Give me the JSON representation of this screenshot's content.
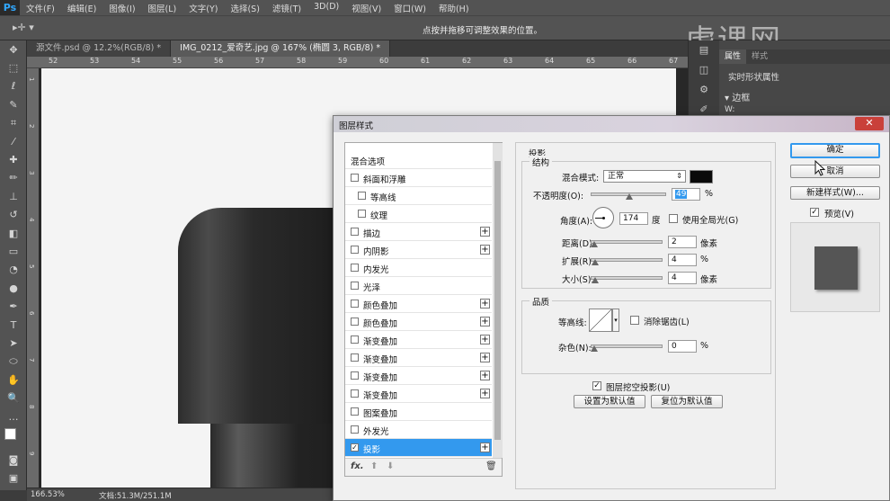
{
  "app": {
    "logo": "Ps",
    "menu": [
      "文件(F)",
      "编辑(E)",
      "图像(I)",
      "图层(L)",
      "文字(Y)",
      "选择(S)",
      "滤镜(T)",
      "3D(D)",
      "视图(V)",
      "窗口(W)",
      "帮助(H)"
    ],
    "options_hint": "点按并拖移可调整效果的位置。",
    "watermark": "虎课网"
  },
  "tabs": [
    {
      "label": "源文件.psd @ 12.2%(RGB/8) *",
      "active": false
    },
    {
      "label": "IMG_0212_爱奇艺.jpg @ 167% (椭圆 3, RGB/8) *",
      "active": true
    }
  ],
  "ruler": {
    "top": [
      "52",
      "53",
      "54",
      "55",
      "56",
      "57",
      "58",
      "59",
      "60",
      "61",
      "62",
      "63",
      "64",
      "65",
      "66",
      "67"
    ],
    "left": [
      "1",
      "2",
      "3",
      "4",
      "5",
      "6",
      "7",
      "8",
      "9"
    ]
  },
  "status": {
    "zoom": "166.53%",
    "doc": "文档:51.3M/251.1M"
  },
  "props": {
    "tabs": [
      "属性",
      "样式"
    ],
    "title": "实时形状属性",
    "section": "边框",
    "w_label": "W:"
  },
  "dialog": {
    "title": "图层样式",
    "close": "✕",
    "styles": [
      {
        "label": "混合选项",
        "checkbox": false,
        "indent": false,
        "plus": false,
        "checked": false,
        "selected": false
      },
      {
        "label": "斜面和浮雕",
        "checkbox": true,
        "indent": false,
        "plus": false,
        "checked": false,
        "selected": false
      },
      {
        "label": "等高线",
        "checkbox": true,
        "indent": true,
        "plus": false,
        "checked": false,
        "selected": false
      },
      {
        "label": "纹理",
        "checkbox": true,
        "indent": true,
        "plus": false,
        "checked": false,
        "selected": false
      },
      {
        "label": "描边",
        "checkbox": true,
        "indent": false,
        "plus": true,
        "checked": false,
        "selected": false
      },
      {
        "label": "内阴影",
        "checkbox": true,
        "indent": false,
        "plus": true,
        "checked": false,
        "selected": false
      },
      {
        "label": "内发光",
        "checkbox": true,
        "indent": false,
        "plus": false,
        "checked": false,
        "selected": false
      },
      {
        "label": "光泽",
        "checkbox": true,
        "indent": false,
        "plus": false,
        "checked": false,
        "selected": false
      },
      {
        "label": "颜色叠加",
        "checkbox": true,
        "indent": false,
        "plus": true,
        "checked": false,
        "selected": false
      },
      {
        "label": "颜色叠加",
        "checkbox": true,
        "indent": false,
        "plus": true,
        "checked": false,
        "selected": false
      },
      {
        "label": "渐变叠加",
        "checkbox": true,
        "indent": false,
        "plus": true,
        "checked": false,
        "selected": false
      },
      {
        "label": "渐变叠加",
        "checkbox": true,
        "indent": false,
        "plus": true,
        "checked": false,
        "selected": false
      },
      {
        "label": "渐变叠加",
        "checkbox": true,
        "indent": false,
        "plus": true,
        "checked": false,
        "selected": false
      },
      {
        "label": "渐变叠加",
        "checkbox": true,
        "indent": false,
        "plus": true,
        "checked": false,
        "selected": false
      },
      {
        "label": "图案叠加",
        "checkbox": true,
        "indent": false,
        "plus": false,
        "checked": false,
        "selected": false
      },
      {
        "label": "外发光",
        "checkbox": true,
        "indent": false,
        "plus": false,
        "checked": false,
        "selected": false
      },
      {
        "label": "投影",
        "checkbox": true,
        "indent": false,
        "plus": true,
        "checked": true,
        "selected": true
      }
    ],
    "footer": {
      "fx": "fx.",
      "up": "⬆",
      "down": "⬇",
      "trash": "🗑"
    },
    "drop_shadow": {
      "heading": "投影",
      "structure": "结构",
      "blend_label": "混合模式:",
      "blend_value": "正常",
      "shadow_color": "#0a0a0a",
      "opacity_label": "不透明度(O):",
      "opacity_value": "49",
      "opacity_unit": "%",
      "angle_label": "角度(A):",
      "angle_value": "174",
      "angle_unit": "度",
      "global_light": "使用全局光(G)",
      "distance_label": "距离(D):",
      "distance_value": "2",
      "distance_unit": "像素",
      "spread_label": "扩展(R):",
      "spread_value": "4",
      "spread_unit": "%",
      "size_label": "大小(S):",
      "size_value": "4",
      "size_unit": "像素",
      "quality": "品质",
      "contour_label": "等高线:",
      "antialias": "消除锯齿(L)",
      "noise_label": "杂色(N):",
      "noise_value": "0",
      "noise_unit": "%",
      "knockout": "图层挖空投影(U)",
      "set_default": "设置为默认值",
      "reset_default": "复位为默认值"
    },
    "buttons": {
      "ok": "确定",
      "cancel": "取消",
      "new_style": "新建样式(W)...",
      "preview": "预览(V)"
    }
  }
}
